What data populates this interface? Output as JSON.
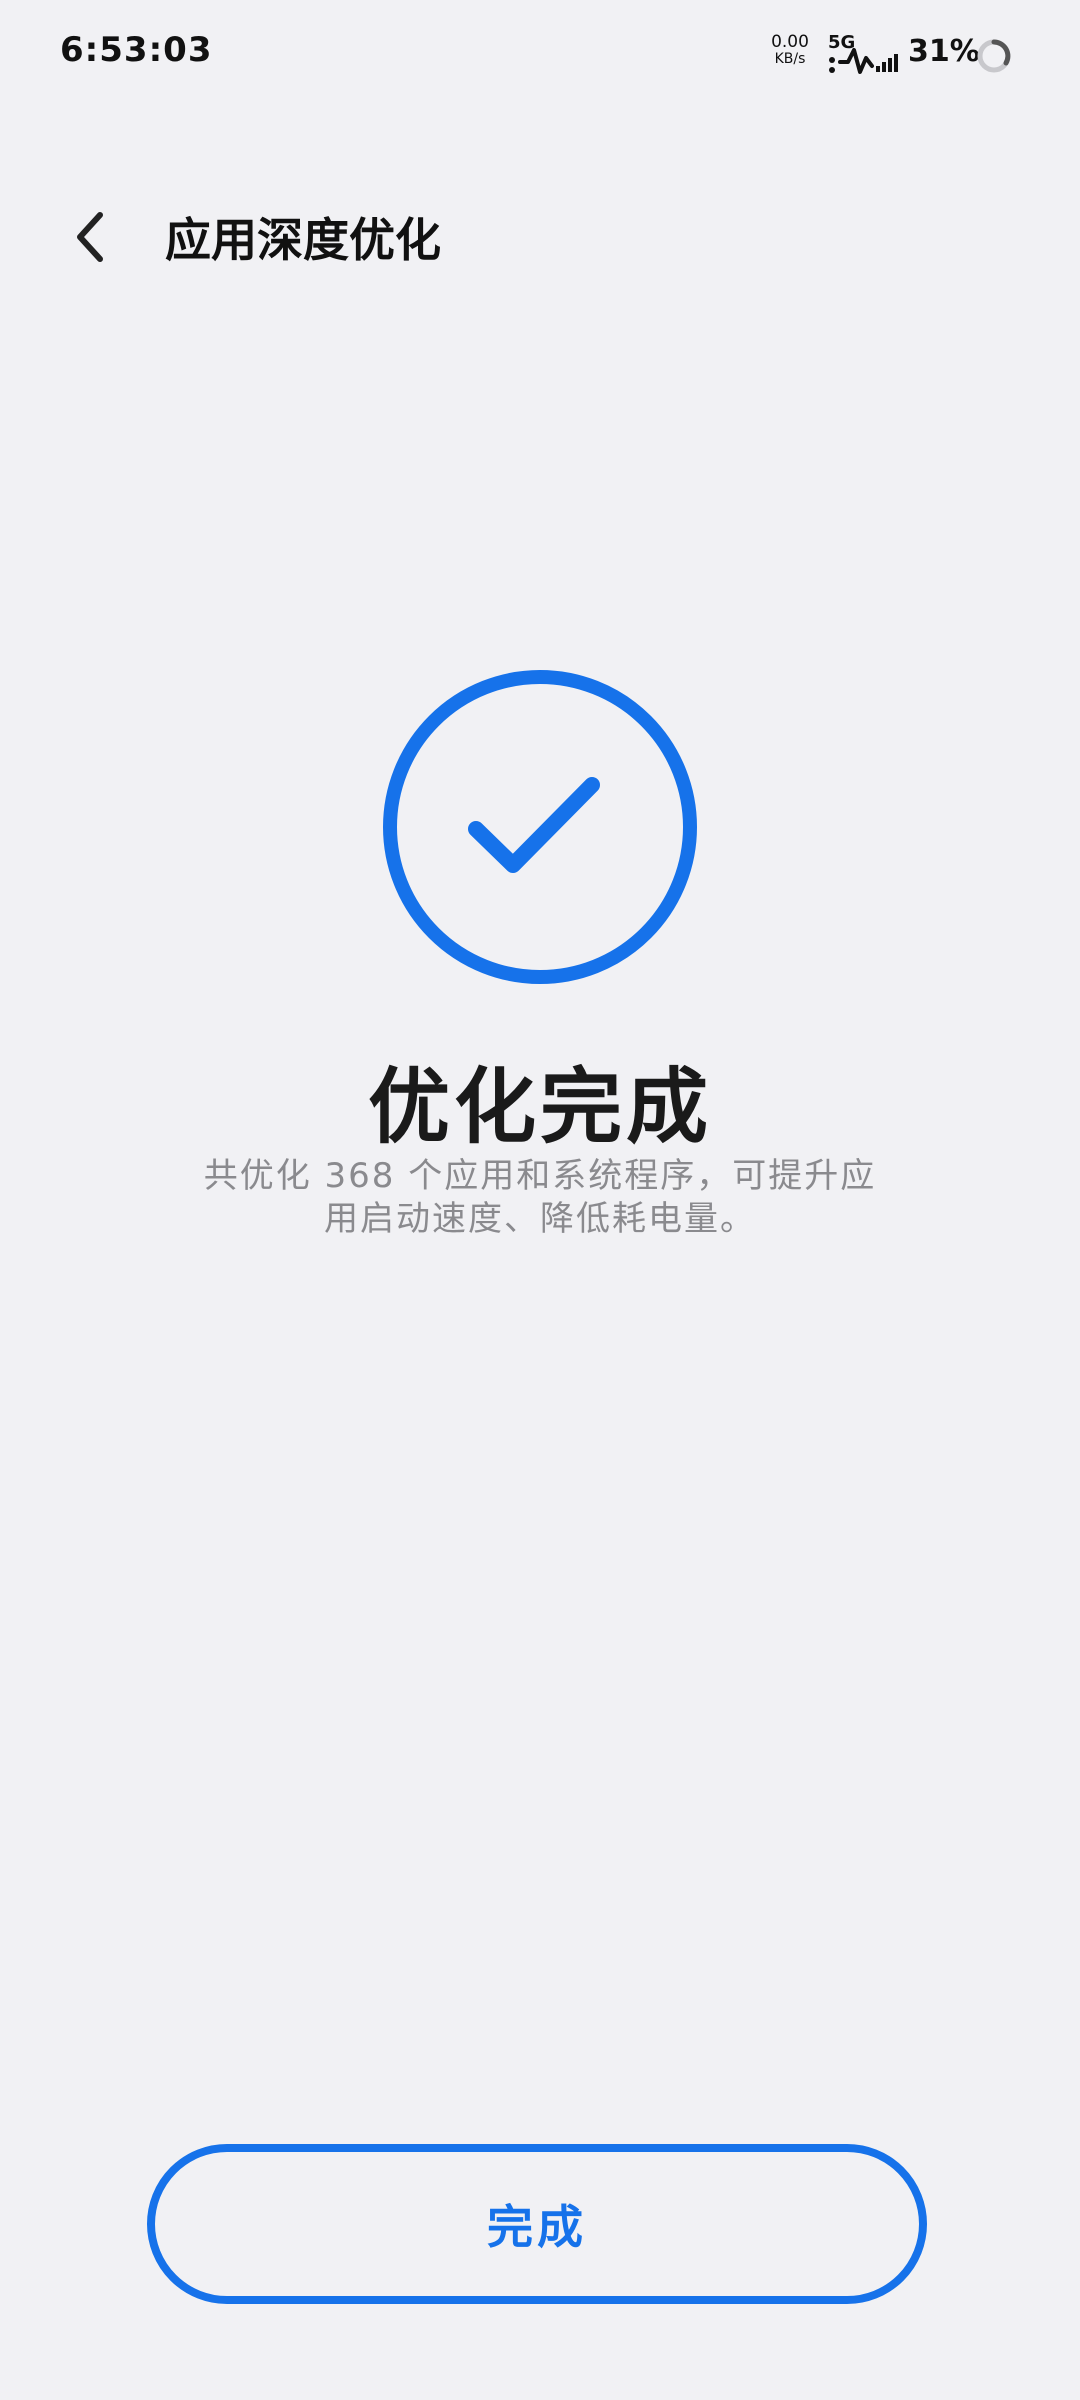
{
  "status_bar": {
    "time": "6:53:03",
    "net_speed_value": "0.00",
    "net_speed_unit": "KB/s",
    "network_type": "5G",
    "battery_percent": "31%",
    "icons": [
      "network-speed",
      "5g-signal-icon",
      "battery-icon"
    ]
  },
  "header": {
    "back_icon": "chevron-left-icon",
    "title": "应用深度优化"
  },
  "result": {
    "icon": "check-circle-icon",
    "title": "优化完成",
    "description": "共优化 368 个应用和系统程序，可提升应用启动速度、降低耗电量。"
  },
  "footer": {
    "done_label": "完成"
  },
  "colors": {
    "background": "#f1f1f4",
    "accent": "#1672ea",
    "text_primary": "#111111",
    "text_secondary": "#8a8a8e"
  }
}
